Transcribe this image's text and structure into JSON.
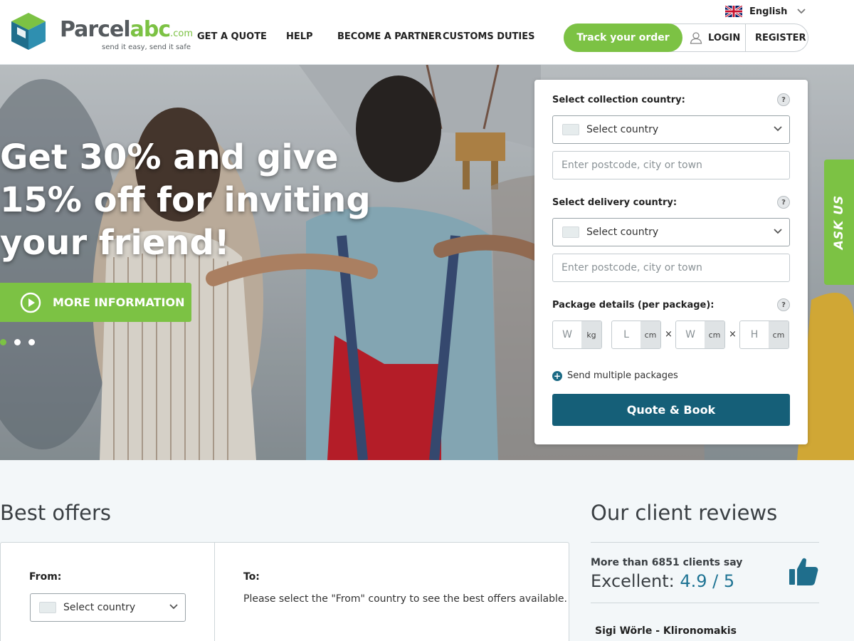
{
  "header": {
    "logo": {
      "word_main": "Parcel",
      "word_accent": "abc",
      "word_suffix": ".com",
      "tagline": "send it easy, send it safe"
    },
    "nav": [
      {
        "label": "GET A QUOTE"
      },
      {
        "label": "HELP"
      },
      {
        "label": "BECOME A PARTNER"
      },
      {
        "label": "CUSTOMS DUTIES"
      }
    ],
    "language": {
      "label": "English"
    },
    "track_label": "Track your order",
    "login_label": "LOGIN",
    "register_label": "REGISTER"
  },
  "hero": {
    "title": "Get 30% and give 15% off for inviting your friend!",
    "cta_label": "MORE INFORMATION",
    "slides": 3,
    "active_slide": 1,
    "ask_us_label": "ASK US"
  },
  "quote_form": {
    "collection_label": "Select collection country:",
    "delivery_label": "Select delivery country:",
    "country_select_value": "Select country",
    "postcode_placeholder": "Enter postcode, city or town",
    "package_label": "Package details (per package):",
    "help_glyph": "?",
    "weight_placeholder": "W",
    "weight_unit": "kg",
    "length_placeholder": "L",
    "width_placeholder": "W",
    "height_placeholder": "H",
    "dim_unit": "cm",
    "times_glyph": "×",
    "multi_label": "Send multiple packages",
    "submit_label": "Quote & Book"
  },
  "best_offers": {
    "title": "Best offers",
    "from_label": "From:",
    "from_select_value": "Select country",
    "to_label": "To:",
    "to_message": "Please select the \"From\" country to see the best offers available."
  },
  "reviews": {
    "title": "Our client reviews",
    "count_text": "More than 6851 clients say",
    "rating_word": "Excellent: ",
    "rating_value": "4.9 / 5",
    "first_reviewer": "Sigi Wörle - Klironomakis"
  },
  "colors": {
    "brand_green": "#7cc244",
    "brand_teal": "#155f78",
    "rating_blue": "#1f7494",
    "text_dark": "#222222"
  },
  "icons": [
    "uk-flag-icon",
    "chevron-down-icon",
    "user-icon",
    "play-icon",
    "help-icon",
    "plus-circle-icon",
    "thumbs-up-icon"
  ]
}
